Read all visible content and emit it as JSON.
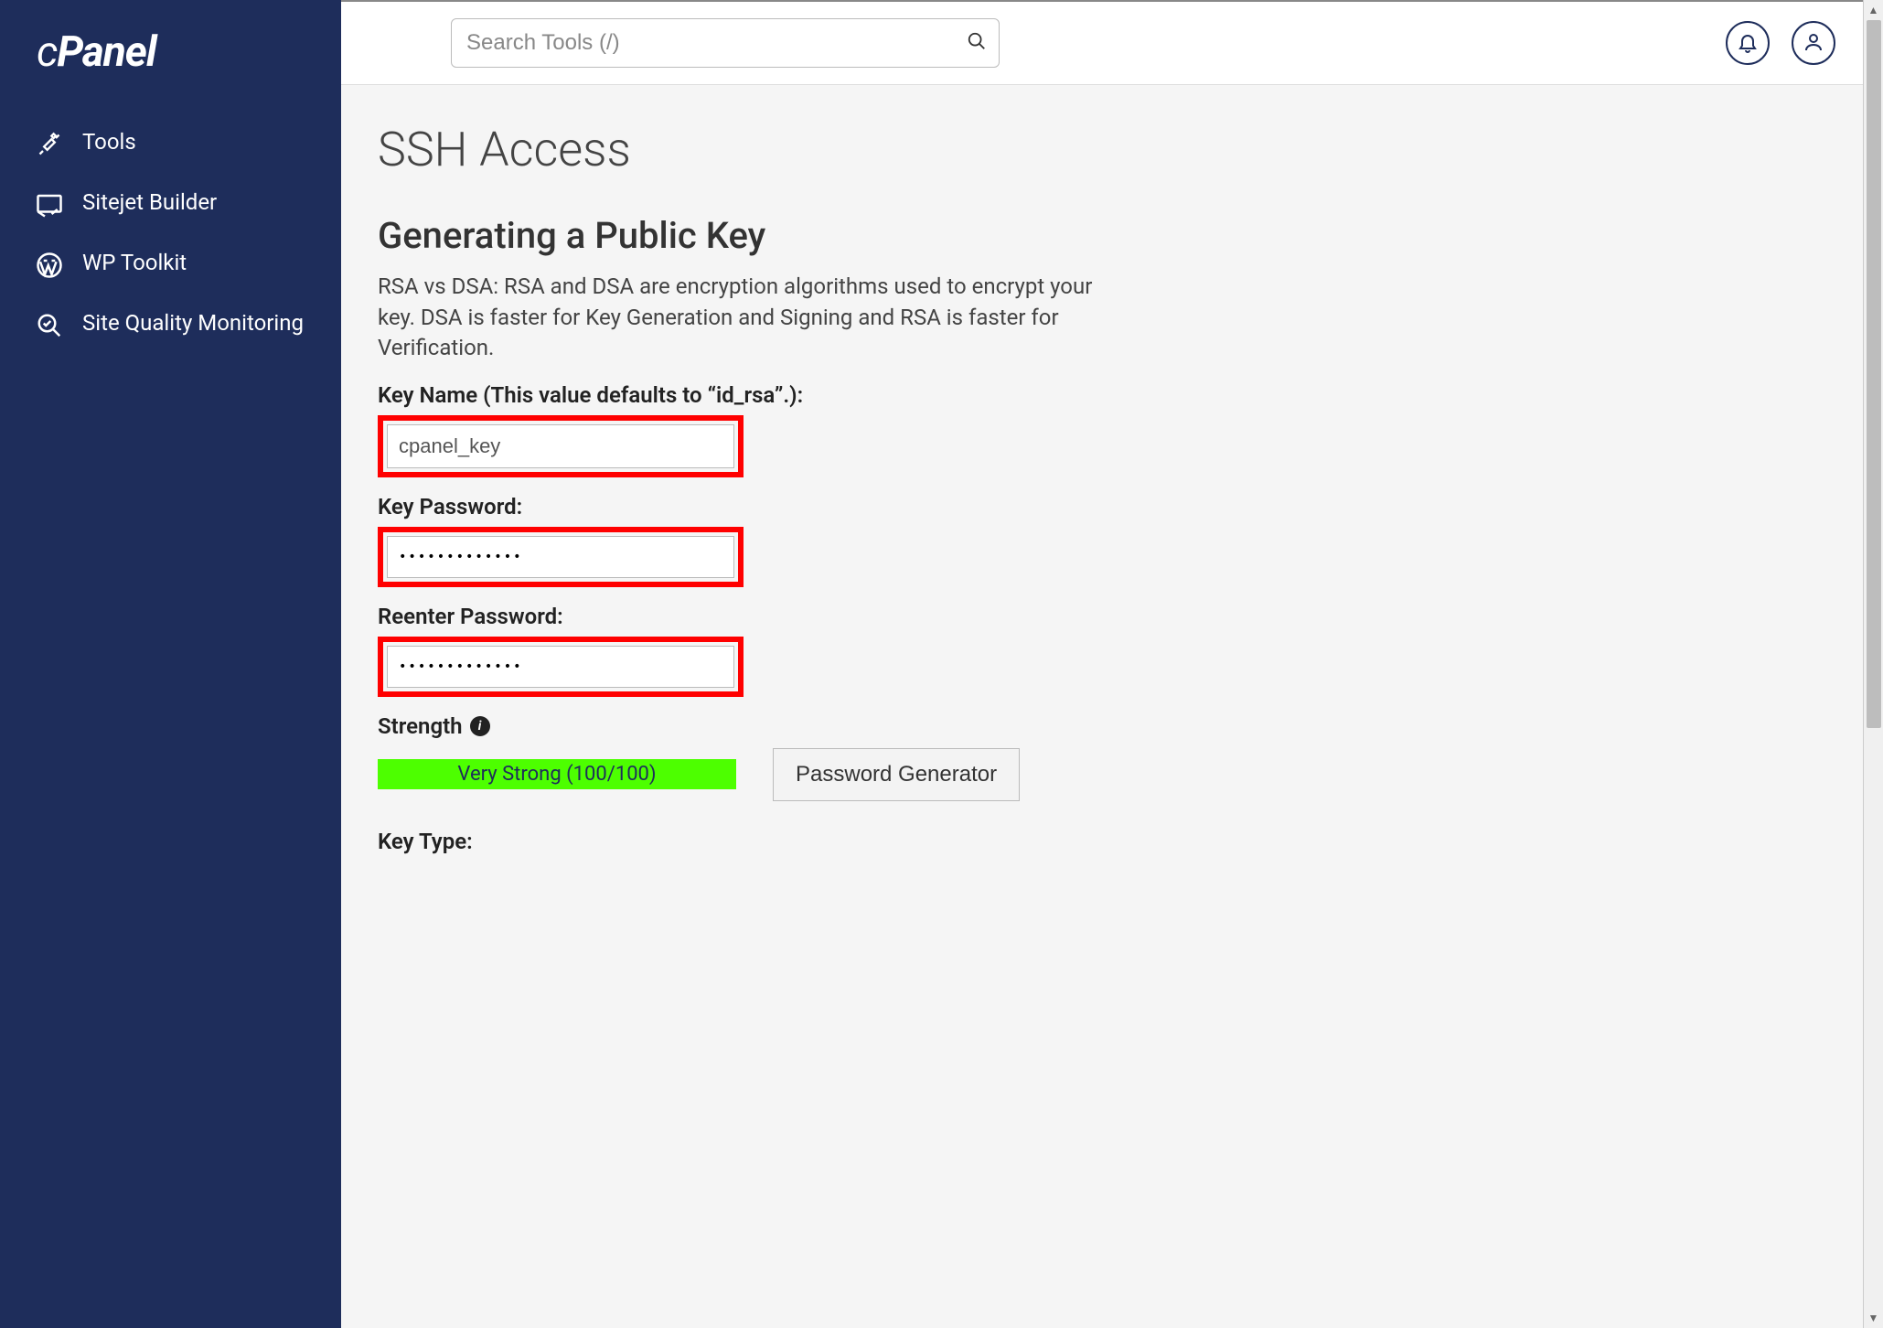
{
  "brand": "cPanel",
  "sidebar": {
    "items": [
      {
        "label": "Tools",
        "icon": "tools-icon"
      },
      {
        "label": "Sitejet Builder",
        "icon": "sitejet-icon"
      },
      {
        "label": "WP Toolkit",
        "icon": "wordpress-icon"
      },
      {
        "label": "Site Quality Monitoring",
        "icon": "magnify-check-icon"
      }
    ]
  },
  "header": {
    "search_placeholder": "Search Tools (/)"
  },
  "page": {
    "title": "SSH Access",
    "section_title": "Generating a Public Key",
    "description": "RSA vs DSA: RSA and DSA are encryption algorithms used to encrypt your key. DSA is faster for Key Generation and Signing and RSA is faster for Verification.",
    "fields": {
      "key_name_label": "Key Name (This value defaults to “id_rsa”.):",
      "key_name_value": "cpanel_key",
      "key_password_label": "Key Password:",
      "key_password_value": "•••••••••••••",
      "reenter_password_label": "Reenter Password:",
      "reenter_password_value": "•••••••••••••",
      "strength_label": "Strength",
      "strength_text": "Very Strong (100/100)",
      "password_generator_label": "Password Generator",
      "key_type_label": "Key Type:"
    }
  },
  "colors": {
    "sidebar_bg": "#1e2d5b",
    "strength_bg": "#4dff00",
    "highlight": "#ff0000"
  }
}
